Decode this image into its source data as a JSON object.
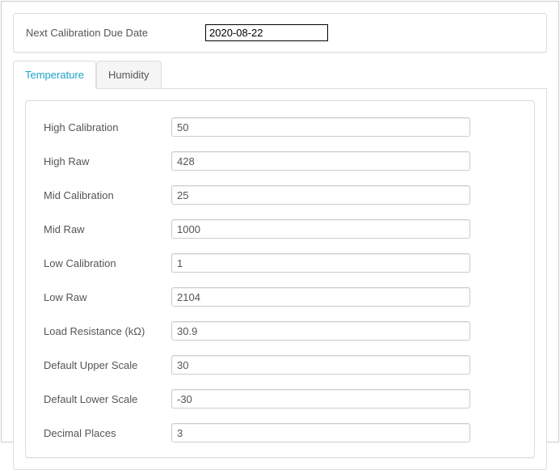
{
  "header": {
    "label": "Next Calibration Due Date",
    "value": "2020-08-22"
  },
  "tabs": [
    {
      "id": "temperature",
      "label": "Temperature",
      "active": true
    },
    {
      "id": "humidity",
      "label": "Humidity",
      "active": false
    }
  ],
  "temperature": {
    "fields": [
      {
        "label": "High Calibration",
        "value": "50"
      },
      {
        "label": "High Raw",
        "value": "428"
      },
      {
        "label": "Mid Calibration",
        "value": "25"
      },
      {
        "label": "Mid Raw",
        "value": "1000"
      },
      {
        "label": "Low Calibration",
        "value": "1"
      },
      {
        "label": "Low Raw",
        "value": "2104"
      },
      {
        "label": "Load Resistance (kΩ)",
        "value": "30.9"
      },
      {
        "label": "Default Upper Scale",
        "value": "30"
      },
      {
        "label": "Default Lower Scale",
        "value": "-30"
      },
      {
        "label": "Decimal Places",
        "value": "3"
      }
    ]
  }
}
